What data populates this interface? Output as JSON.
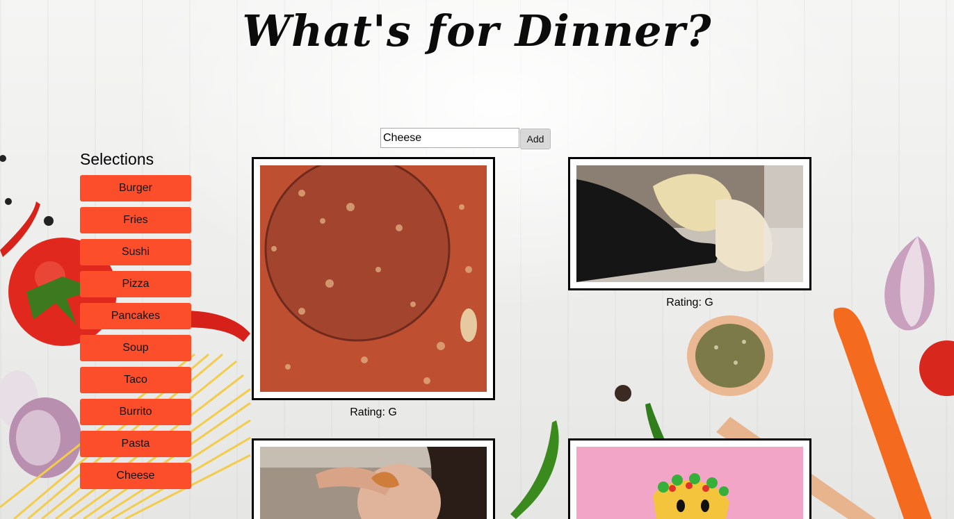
{
  "header": {
    "title": "What's for Dinner?"
  },
  "search": {
    "value": "Cheese",
    "add_label": "Add"
  },
  "sidebar": {
    "heading": "Selections",
    "items": [
      {
        "label": "Burger"
      },
      {
        "label": "Fries"
      },
      {
        "label": "Sushi"
      },
      {
        "label": "Pizza"
      },
      {
        "label": "Pancakes"
      },
      {
        "label": "Soup"
      },
      {
        "label": "Taco"
      },
      {
        "label": "Burrito"
      },
      {
        "label": "Pasta"
      },
      {
        "label": "Cheese"
      }
    ]
  },
  "gifs": [
    {
      "rating": "Rating: G"
    },
    {
      "rating": "Rating: G"
    },
    {
      "rating": ""
    },
    {
      "rating": ""
    }
  ],
  "colors": {
    "button": "#fd4e2c",
    "frame": "#000000",
    "background": "#f1f1f0"
  }
}
